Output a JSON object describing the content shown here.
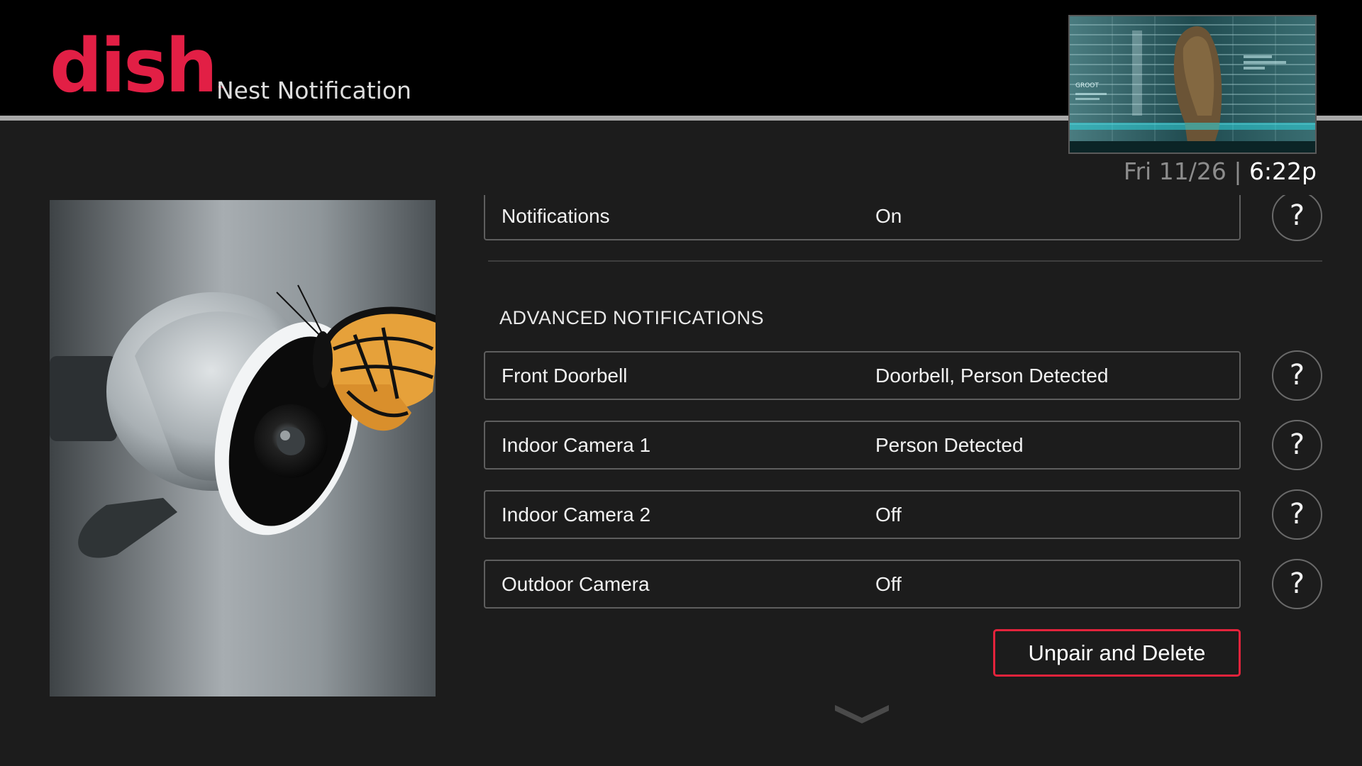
{
  "header": {
    "logo_text": "dish",
    "logo_tm": "™",
    "title": "Nest Notification",
    "thumbnail_caption": "GROOT"
  },
  "status": {
    "date": "Fri 11/26",
    "separator": " | ",
    "time": "6:22p"
  },
  "settings": {
    "partial_row": {
      "label": "Notifications",
      "value": "On"
    },
    "section_heading": "ADVANCED NOTIFICATIONS",
    "rows": [
      {
        "label": "Front Doorbell",
        "value": "Doorbell, Person Detected"
      },
      {
        "label": "Indoor Camera 1",
        "value": "Person Detected"
      },
      {
        "label": "Indoor Camera 2",
        "value": "Off"
      },
      {
        "label": "Outdoor Camera",
        "value": "Off"
      }
    ],
    "help_glyph": "?",
    "unpair_label": "Unpair and Delete"
  },
  "icons": {
    "help": "question-mark-icon",
    "scroll": "chevron-down-icon"
  },
  "colors": {
    "brand": "#e21f45",
    "background": "#1c1c1c",
    "header": "#000000",
    "focus_border": "#e3233c"
  }
}
